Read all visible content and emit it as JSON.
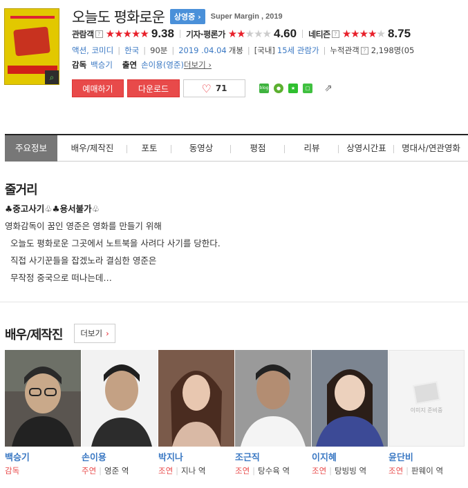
{
  "movie": {
    "title": "오늘도 평화로운",
    "status_badge": "상영중 ›",
    "eng_title": "Super Margin , 2019"
  },
  "ratings": [
    {
      "label": "관람객",
      "score": "9.38",
      "stars_on": 5,
      "has_q": true
    },
    {
      "label": "기자·평론가",
      "score": "4.60",
      "stars_on": 2,
      "has_q": true
    },
    {
      "label": "네티즌",
      "score": "8.75",
      "stars_on": 4,
      "has_q": true
    }
  ],
  "info": {
    "genre": "액션, 코미디",
    "country": "한국",
    "runtime": "90분",
    "release_date": "2019 .04.04",
    "release_suffix": "개봉",
    "rating_prefix": "[국내]",
    "rating": "15세 관람가",
    "audience_label": "누적관객",
    "audience_value": "2,198명(05"
  },
  "people": {
    "director_label": "감독",
    "director": "백승기",
    "cast_label": "출연",
    "cast": "손이용(영준)",
    "more": "더보기 ›"
  },
  "buttons": {
    "reserve": "예매하기",
    "download": "다운로드",
    "like_count": "71"
  },
  "share": {
    "blog": "blog"
  },
  "tabs": [
    "주요정보",
    "배우/제작진",
    "포토",
    "동영상",
    "평점",
    "리뷰",
    "상영시간표",
    "명대사/연관영화"
  ],
  "synopsis": {
    "title": "줄거리",
    "head": "♣중고사기♧♣용서불가♧",
    "lines": [
      "영화감독이 꿈인 영준은 영화를 만들기 위해",
      "  오늘도 평화로운 그곳에서 노트북을 사려다 사기를 당한다.",
      "  직접 사기꾼들을 잡겠노라 결심한 영준은",
      "  무작정 중국으로 떠나는데…"
    ]
  },
  "cast_section": {
    "title": "배우/제작진",
    "more": "더보기",
    "noimage_text": "이미지 준비중",
    "members": [
      {
        "name": "백승기",
        "role": "감독",
        "character": ""
      },
      {
        "name": "손이용",
        "role": "주연",
        "character": "영준 역"
      },
      {
        "name": "박지나",
        "role": "조연",
        "character": "지나 역"
      },
      {
        "name": "조근직",
        "role": "조연",
        "character": "탕수육 역"
      },
      {
        "name": "이지혜",
        "role": "조연",
        "character": "탕빙빙 역"
      },
      {
        "name": "윤단비",
        "role": "조연",
        "character": "판웨이 역"
      }
    ]
  },
  "colors": {
    "accent_red": "#e84a4a",
    "link_blue": "#3a78c3",
    "badge_blue": "#4a90d9"
  }
}
